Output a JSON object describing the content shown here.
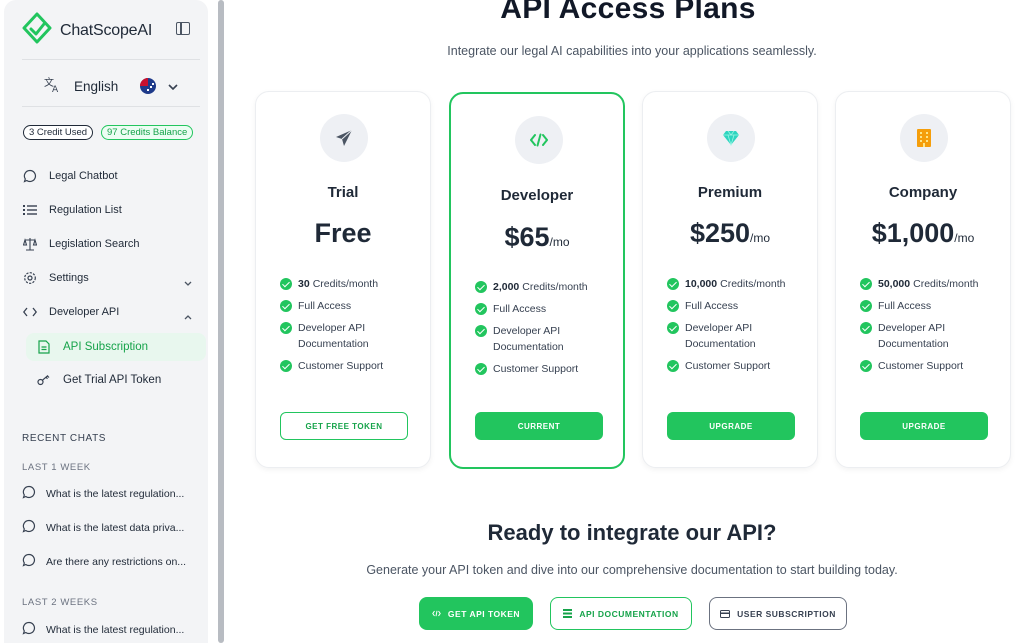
{
  "app": {
    "brand": "ChatScopeAI"
  },
  "sidebar": {
    "language": "English",
    "credits_used": "3 Credit Used",
    "credits_balance": "97 Credits Balance",
    "nav": [
      {
        "label": "Legal Chatbot",
        "icon": "chat-bubble-icon"
      },
      {
        "label": "Regulation List",
        "icon": "list-icon"
      },
      {
        "label": "Legislation Search",
        "icon": "scales-icon"
      },
      {
        "label": "Settings",
        "icon": "gear-icon"
      },
      {
        "label": "Developer API",
        "icon": "code-icon"
      }
    ],
    "sub_nav": [
      {
        "label": "API Subscription",
        "icon": "document-icon",
        "active": true
      },
      {
        "label": "Get Trial API Token",
        "icon": "key-icon",
        "active": false
      }
    ],
    "recent_title": "RECENT CHATS",
    "groups": [
      {
        "label": "LAST 1 WEEK",
        "chats": [
          "What is the latest regulation...",
          "What is the latest data priva...",
          "Are there any restrictions on..."
        ]
      },
      {
        "label": "LAST 2 WEEKS",
        "chats": [
          "What is the latest regulation..."
        ]
      }
    ]
  },
  "main": {
    "title": "API Access Plans",
    "subtitle": "Integrate our legal AI capabilities into your applications seamlessly.",
    "plans": [
      {
        "name": "Trial",
        "price": "Free",
        "per": "",
        "credits_num": "30",
        "credits_text": "Credits/month",
        "features": [
          "Full Access",
          "Developer API Documentation",
          "Customer Support"
        ],
        "button": "GET FREE TOKEN",
        "icon": "paper-plane-icon",
        "icon_color": "#4b5563"
      },
      {
        "name": "Developer",
        "price": "$65",
        "per": "/mo",
        "credits_num": "2,000",
        "credits_text": "Credits/month",
        "features": [
          "Full Access",
          "Developer API Documentation",
          "Customer Support"
        ],
        "button": "CURRENT",
        "icon": "code-icon",
        "icon_color": "#22c55e"
      },
      {
        "name": "Premium",
        "price": "$250",
        "per": "/mo",
        "credits_num": "10,000",
        "credits_text": "Credits/month",
        "features": [
          "Full Access",
          "Developer API Documentation",
          "Customer Support"
        ],
        "button": "UPGRADE",
        "icon": "diamond-icon",
        "icon_color": "#2dd4bf"
      },
      {
        "name": "Company",
        "price": "$1,000",
        "per": "/mo",
        "credits_num": "50,000",
        "credits_text": "Credits/month",
        "features": [
          "Full Access",
          "Developer API Documentation",
          "Customer Support"
        ],
        "button": "UPGRADE",
        "icon": "building-icon",
        "icon_color": "#f59e0b"
      }
    ],
    "cta": {
      "title": "Ready to integrate our API?",
      "subtitle": "Generate your API token and dive into our comprehensive documentation to start building today.",
      "buttons": [
        "GET API TOKEN",
        "API DOCUMENTATION",
        "USER SUBSCRIPTION"
      ]
    }
  },
  "colors": {
    "accent": "#22c55e",
    "accent_dark": "#16a34a",
    "sidebar_bg": "#f3f4f6"
  }
}
